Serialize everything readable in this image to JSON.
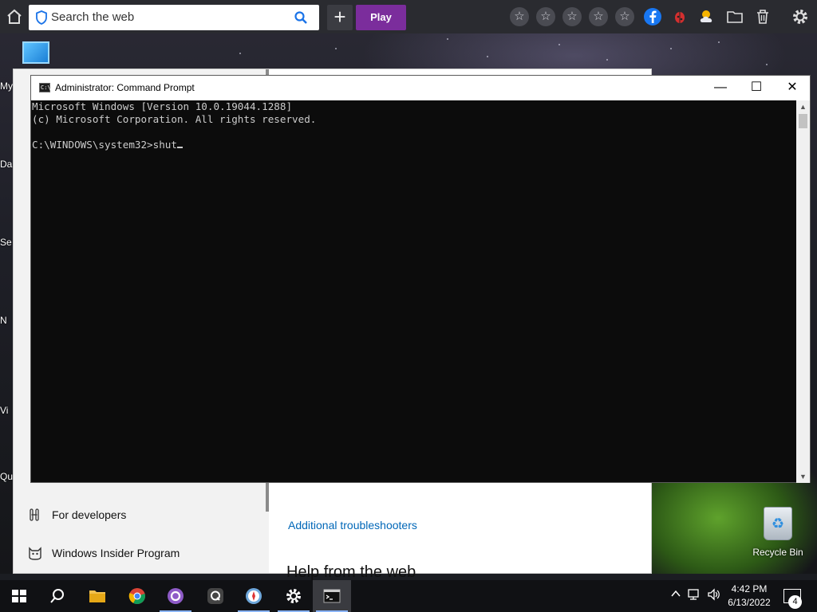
{
  "browser_toolbar": {
    "search_placeholder": "Search the web",
    "plus_label": "+",
    "play_label": "Play",
    "icons": [
      "home-icon",
      "star-icon",
      "star-icon",
      "star-icon",
      "star-icon",
      "star-icon",
      "facebook-icon",
      "bug-icon",
      "weather-icon",
      "folder-icon",
      "trash-icon",
      "gear-icon"
    ]
  },
  "desktop": {
    "left_labels": [
      "My",
      "Da",
      "Se",
      "N",
      "Vi",
      "Qu"
    ],
    "recycle_bin_label": "Recycle Bin"
  },
  "settings_window": {
    "sidebar_items": [
      {
        "label": "For developers",
        "icon": "developer-tools-icon"
      },
      {
        "label": "Windows Insider Program",
        "icon": "insider-cat-icon"
      }
    ],
    "main": {
      "link": "Additional troubleshooters",
      "heading": "Help from the web"
    }
  },
  "cmd_window": {
    "title": "Administrator: Command Prompt",
    "app_icon_text": "C:\\_",
    "lines": [
      "Microsoft Windows [Version 10.0.19044.1288]",
      "(c) Microsoft Corporation. All rights reserved.",
      "",
      "C:\\WINDOWS\\system32>shut"
    ],
    "controls": {
      "minimize": "—",
      "maximize": "☐",
      "close": "✕"
    }
  },
  "taskbar": {
    "apps": [
      "windows-start-icon",
      "search-icon",
      "file-explorer-icon",
      "chrome-icon",
      "app-circle-icon",
      "app-q-icon",
      "app-compass-icon",
      "settings-gear-icon",
      "command-prompt-icon"
    ],
    "time": "4:42 PM",
    "date": "6/13/2022",
    "notification_count": "4"
  }
}
